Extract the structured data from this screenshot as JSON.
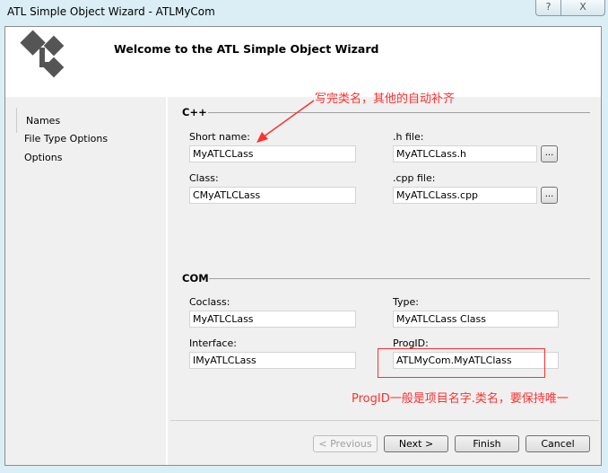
{
  "window": {
    "title": "ATL Simple Object Wizard - ATLMyCom",
    "help": "?",
    "close": "X"
  },
  "header": {
    "title": "Welcome to the ATL Simple Object Wizard"
  },
  "sidebar": {
    "items": [
      {
        "label": "Names"
      },
      {
        "label": "File Type Options"
      },
      {
        "label": "Options"
      }
    ]
  },
  "cpp": {
    "section": "C++",
    "short_name_label": "Short name:",
    "short_name": "MyATLCLass",
    "h_file_label": ".h file:",
    "h_file": "MyATLCLass.h",
    "class_label": "Class:",
    "class": "CMyATLCLass",
    "cpp_file_label": ".cpp file:",
    "cpp_file": "MyATLCLass.cpp",
    "browse": "..."
  },
  "com": {
    "section": "COM",
    "coclass_label": "Coclass:",
    "coclass": "MyATLCLass",
    "type_label": "Type:",
    "type": "MyATLCLass Class",
    "interface_label": "Interface:",
    "interface": "IMyATLCLass",
    "progid_label": "ProgID:",
    "progid": "ATLMyCom.MyATLClass"
  },
  "annotations": {
    "top": "写完类名，其他的自动补齐",
    "bottom": "ProgID一般是项目名字.类名，要保持唯一",
    "color": "#ff3030"
  },
  "buttons": {
    "previous": "< Previous",
    "next": "Next >",
    "finish": "Finish",
    "cancel": "Cancel"
  }
}
